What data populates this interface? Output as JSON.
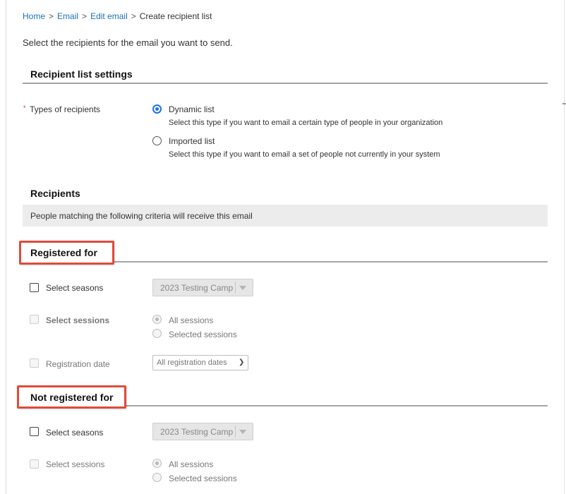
{
  "breadcrumb": {
    "home": "Home",
    "email": "Email",
    "edit_email": "Edit email",
    "current": "Create recipient list",
    "separator": ">"
  },
  "intro": "Select the recipients for the email you want to send.",
  "settings": {
    "title": "Recipient list settings",
    "required_marker": "*",
    "types_label": "Types of recipients",
    "options": [
      {
        "label": "Dynamic list",
        "help": "Select this type if you want to email a certain type of people in your organization",
        "selected": true
      },
      {
        "label": "Imported list",
        "help": "Select this type if you want to email a set of people not currently in your system",
        "selected": false
      }
    ]
  },
  "recipients": {
    "title": "Recipients",
    "banner": "People matching the following criteria will receive this email"
  },
  "registered": {
    "title": "Registered for",
    "select_seasons_label": "Select seasons",
    "season_value": "2023 Testing Camp",
    "select_sessions_label": "Select sessions",
    "session_options": [
      "All sessions",
      "Selected sessions"
    ],
    "registration_date_label": "Registration date",
    "registration_date_value": "All registration dates"
  },
  "not_registered": {
    "title": "Not registered for",
    "select_seasons_label": "Select seasons",
    "season_value": "2023 Testing Camp",
    "select_sessions_label": "Select sessions",
    "session_options": [
      "All sessions",
      "Selected sessions"
    ]
  },
  "colors": {
    "link": "#1a73b8",
    "radio_selected": "#1a73e8",
    "highlight_border": "#e04b3a",
    "banner_bg": "#ececec"
  }
}
